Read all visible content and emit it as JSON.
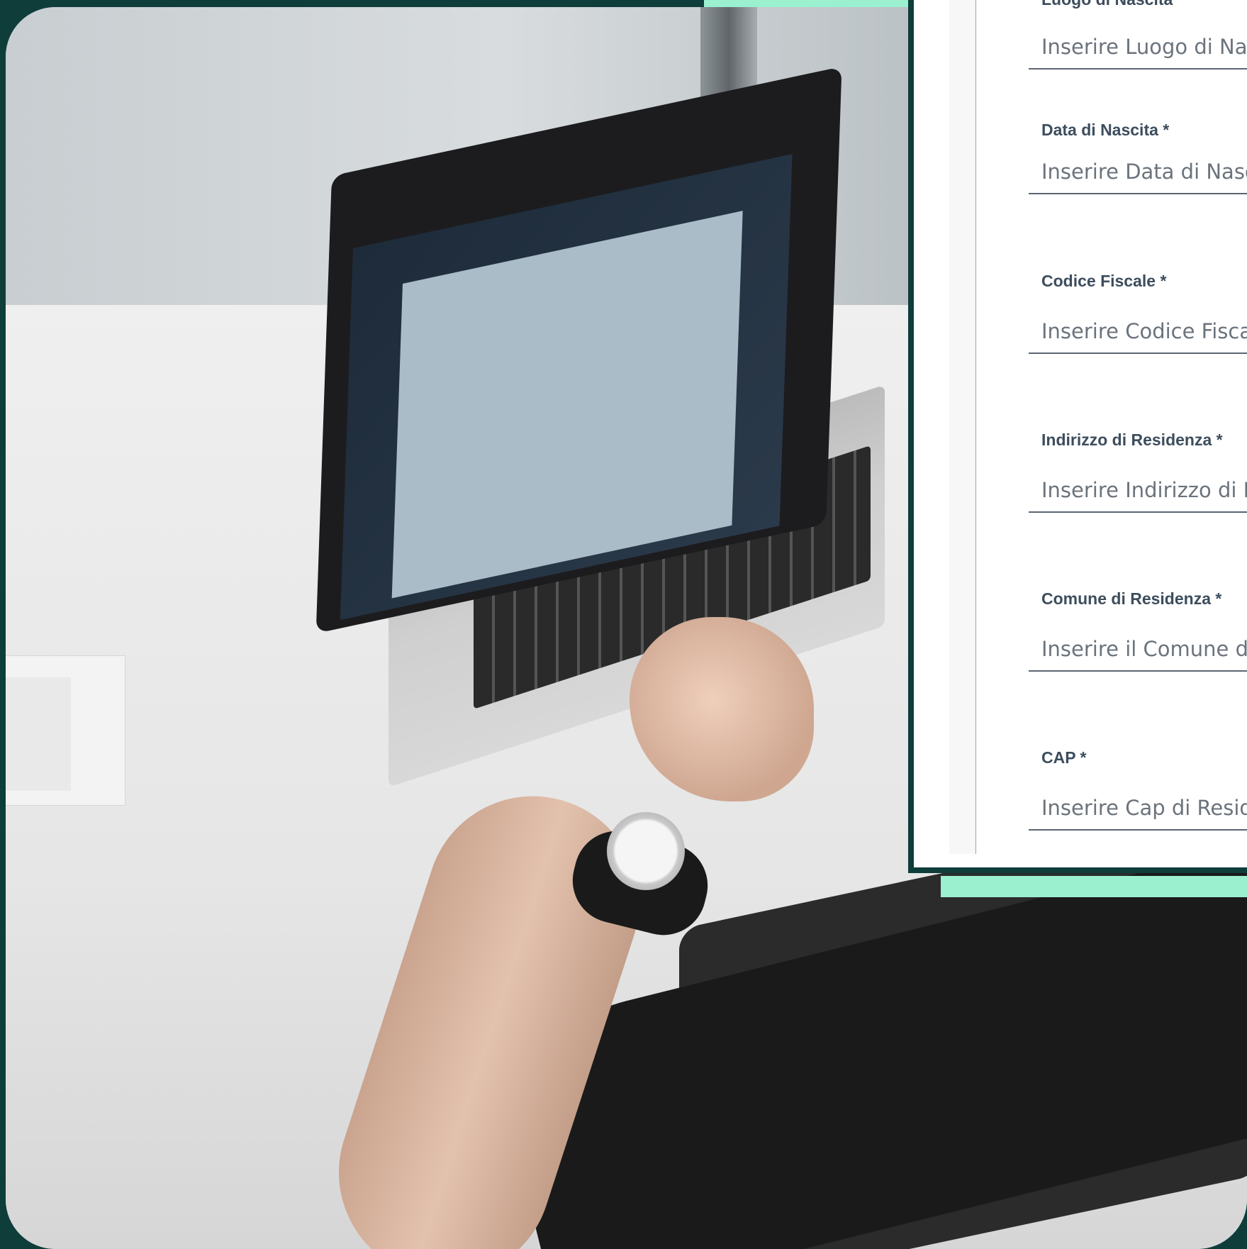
{
  "form": {
    "fields": [
      {
        "label": "Luogo di Nascita",
        "placeholder": "Inserire Luogo di Nascita"
      },
      {
        "label": "Data di Nascita *",
        "placeholder": "Inserire Data di Nascita"
      },
      {
        "label": "Codice Fiscale *",
        "placeholder": "Inserire Codice Fiscale"
      },
      {
        "label": "Indirizzo di Residenza *",
        "placeholder": "Inserire Indirizzo di Residenza"
      },
      {
        "label": "Comune di Residenza *",
        "placeholder": "Inserire il Comune di Residenza"
      },
      {
        "label": "CAP *",
        "placeholder": "Inserire Cap di Residenza"
      }
    ]
  },
  "colors": {
    "background": "#0f3d3a",
    "accent": "#9af0cf",
    "label": "#3d4d5d",
    "input_underline": "#5b6571"
  }
}
